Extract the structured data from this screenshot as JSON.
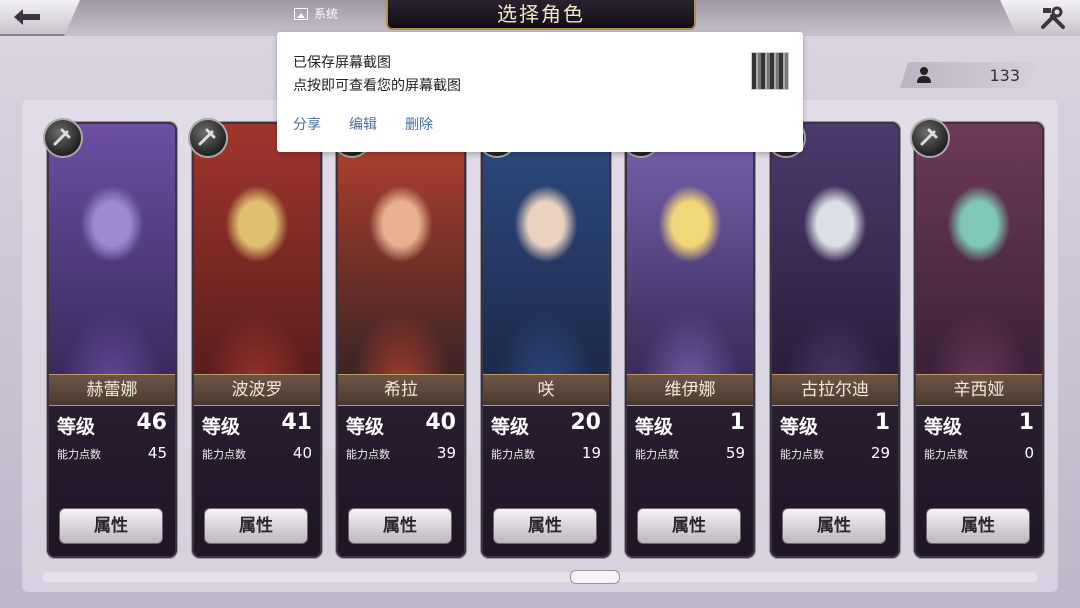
{
  "header": {
    "title": "选择角色",
    "system_label": "系统"
  },
  "counter": {
    "value": "133"
  },
  "toast": {
    "line1": "已保存屏幕截图",
    "line2": "点按即可查看您的屏幕截图",
    "actions": [
      "分享",
      "编辑",
      "删除"
    ]
  },
  "cards": [
    {
      "name": "赫蕾娜",
      "level_label": "等级",
      "level": "46",
      "points_label": "能力点数",
      "points": "45",
      "button": "属性",
      "colors": [
        "#3b2a5c",
        "#6b4fa3",
        "#9d8ad0"
      ]
    },
    {
      "name": "波波罗",
      "level_label": "等级",
      "level": "41",
      "points_label": "能力点数",
      "points": "40",
      "button": "属性",
      "colors": [
        "#5a1d1d",
        "#a2362d",
        "#e0c070"
      ]
    },
    {
      "name": "希拉",
      "level_label": "等级",
      "level": "40",
      "points_label": "能力点数",
      "points": "39",
      "button": "属性",
      "colors": [
        "#3b2424",
        "#b8412f",
        "#e8b090"
      ]
    },
    {
      "name": "咲",
      "level_label": "等级",
      "level": "20",
      "points_label": "能力点数",
      "points": "19",
      "button": "属性",
      "colors": [
        "#1c2a4a",
        "#2f4b82",
        "#e9d2c0"
      ]
    },
    {
      "name": "维伊娜",
      "level_label": "等级",
      "level": "1",
      "points_label": "能力点数",
      "points": "59",
      "button": "属性",
      "colors": [
        "#3a2b5a",
        "#7a64b0",
        "#f2d67a"
      ]
    },
    {
      "name": "古拉尔迪",
      "level_label": "等级",
      "level": "1",
      "points_label": "能力点数",
      "points": "29",
      "button": "属性",
      "colors": [
        "#2a1e3a",
        "#4d3a6e",
        "#dcdfe6"
      ]
    },
    {
      "name": "辛西娅",
      "level_label": "等级",
      "level": "1",
      "points_label": "能力点数",
      "points": "0",
      "button": "属性",
      "colors": [
        "#3a2236",
        "#6e3a5a",
        "#7fc8b8"
      ]
    }
  ]
}
